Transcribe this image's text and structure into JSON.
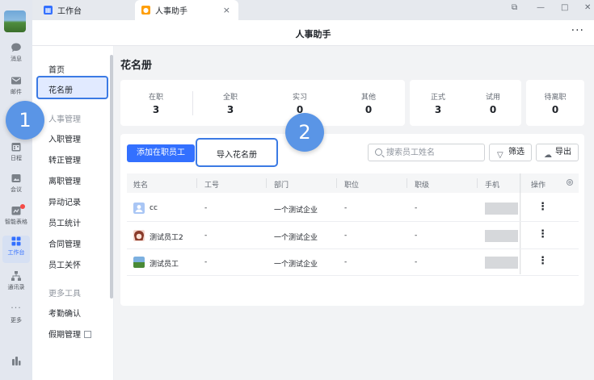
{
  "tabs": [
    {
      "label": "工作台",
      "icon": "grid-icon",
      "color": "#3370ff"
    },
    {
      "label": "人事助手",
      "icon": "person-icon",
      "color": "#ff9f0a",
      "close": "×"
    }
  ],
  "window_controls": {
    "pin": "⧉",
    "minimize": "—",
    "maximize": "□",
    "close": "✕"
  },
  "titlebar": {
    "title": "人事助手",
    "more": "···"
  },
  "rail": [
    {
      "label": "消息",
      "icon": "chat-bubble-icon"
    },
    {
      "label": "邮件",
      "icon": "mail-icon"
    },
    {
      "label": "日程",
      "icon": "calendar-icon"
    },
    {
      "label": "会议",
      "icon": "video-icon"
    },
    {
      "label": "智能表格",
      "icon": "sheet-icon"
    },
    {
      "label": "工作台",
      "icon": "grid-icon",
      "active": true
    },
    {
      "label": "通讯录",
      "icon": "org-chart-icon"
    },
    {
      "label": "更多",
      "icon": "more-dots-icon",
      "glyph": "···"
    }
  ],
  "nav": {
    "home": "首页",
    "roster": "花名册",
    "section1": "人事管理",
    "items1": [
      "入职管理",
      "转正管理",
      "离职管理",
      "异动记录",
      "员工统计",
      "合同管理",
      "员工关怀"
    ],
    "section2": "更多工具",
    "items2": [
      "考勤确认",
      "假期管理"
    ]
  },
  "page_title": "花名册",
  "stats_group1": [
    {
      "label": "在职",
      "value": "3"
    },
    {
      "label": "全职",
      "value": "3"
    },
    {
      "label": "实习",
      "value": "0"
    },
    {
      "label": "其他",
      "value": "0"
    }
  ],
  "stats_group2": [
    {
      "label": "正式",
      "value": "3"
    },
    {
      "label": "试用",
      "value": "0"
    }
  ],
  "stats_group3": [
    {
      "label": "待离职",
      "value": "0"
    }
  ],
  "toolbar": {
    "add_label": "添加在职员工",
    "import_label": "导入花名册",
    "search_placeholder": "搜索员工姓名",
    "filter_label": "筛选",
    "export_label": "导出"
  },
  "table": {
    "columns": [
      "姓名",
      "工号",
      "部门",
      "职位",
      "职级",
      "手机",
      "操作"
    ],
    "rows": [
      {
        "name": "cc",
        "id": "-",
        "dept": "一个测试企业",
        "position": "-",
        "level": "-",
        "avatar": "default-avatar-icon"
      },
      {
        "name": "测试员工2",
        "id": "-",
        "dept": "一个测试企业",
        "position": "-",
        "level": "-",
        "avatar": "anime-avatar-icon"
      },
      {
        "name": "测试员工",
        "id": "-",
        "dept": "一个测试企业",
        "position": "-",
        "level": "-",
        "avatar": "landscape-avatar-icon"
      }
    ],
    "action_glyph": "⋮"
  },
  "annotations": [
    {
      "label": "1"
    },
    {
      "label": "2"
    }
  ],
  "colors": {
    "accent": "#3370ff",
    "badge": "#5a95e6",
    "highlight_border": "#3b7ae4"
  }
}
